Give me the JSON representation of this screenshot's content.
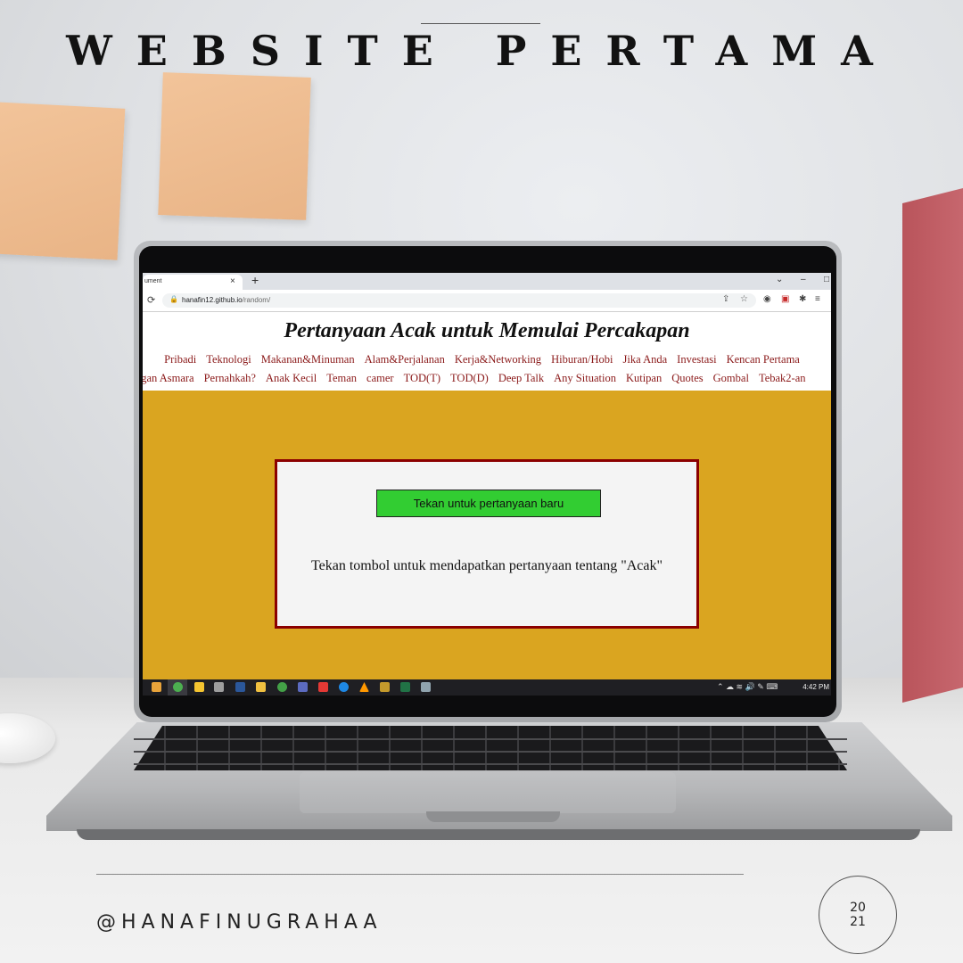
{
  "poster": {
    "title": "WEBSITE PERTAMA",
    "handle": "@HANAFINUGRAHAA",
    "year_top": "20",
    "year_bottom": "21"
  },
  "browser": {
    "tab_title": "ument",
    "tab_close": "×",
    "new_tab": "+",
    "window_controls": [
      "⌄",
      "–",
      "□"
    ],
    "url_host": "hanafin12.github.io",
    "url_path": "/random/"
  },
  "page": {
    "title": "Pertanyaan Acak untuk Memulai Percakapan",
    "nav_row1": [
      "Pribadi",
      "Teknologi",
      "Makanan&Minuman",
      "Alam&Perjalanan",
      "Kerja&Networking",
      "Hiburan/Hobi",
      "Jika Anda",
      "Investasi",
      "Kencan Pertama"
    ],
    "nav_row2": [
      "ngan Asmara",
      "Pernahkah?",
      "Anak Kecil",
      "Teman",
      "camer",
      "TOD(T)",
      "TOD(D)",
      "Deep Talk",
      "Any Situation",
      "Kutipan",
      "Quotes",
      "Gombal",
      "Tebak2-an"
    ],
    "button_label": "Tekan untuk pertanyaan baru",
    "question_text": "Tekan tombol untuk mendapatkan pertanyaan tentang \"Acak\""
  },
  "taskbar": {
    "clock": "4:42 PM"
  },
  "colors": {
    "page_background": "#daa520",
    "button": "#32cd32",
    "card_border": "#8b0000",
    "nav_link": "#8b1a1a"
  }
}
